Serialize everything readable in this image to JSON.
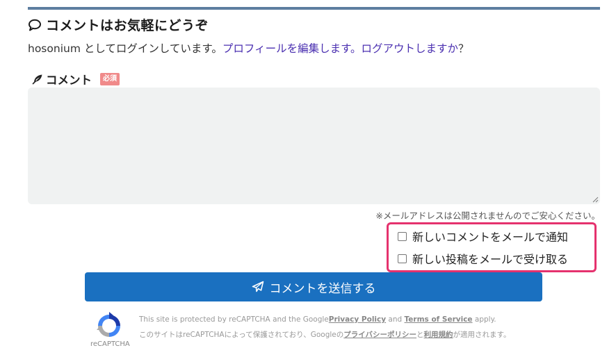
{
  "header": {
    "title": "コメントはお気軽にどうぞ",
    "login_user_text": "hosonium としてログインしています。",
    "edit_profile_link": "プロフィールを編集します。",
    "logout_link": "ログアウトしますか",
    "logout_suffix": "？"
  },
  "comment_field": {
    "label": "コメント",
    "required_badge": "必須",
    "value": "",
    "placeholder": ""
  },
  "notice": "※メールアドレスは公開されませんのでご安心ください。",
  "options": [
    {
      "label": "新しいコメントをメールで通知",
      "checked": false
    },
    {
      "label": "新しい投稿をメールで受け取る",
      "checked": false
    }
  ],
  "submit": {
    "label": "コメントを送信する"
  },
  "recaptcha": {
    "logo_label": "reCAPTCHA",
    "line1_prefix": "This site is protected by reCAPTCHA and the Google",
    "privacy_link": "Privacy Policy",
    "line1_and": " and ",
    "terms_link": "Terms of Service",
    "line1_suffix": " apply.",
    "line2_prefix": "このサイトはreCAPTCHAによって保護されており、Googleの",
    "privacy_link_ja": "プライバシーポリシー",
    "line2_and": "と",
    "terms_link_ja": "利用規約",
    "line2_suffix": "が適用されます。"
  },
  "colors": {
    "accent_rule": "#5d7ea0",
    "link": "#4a2fb0",
    "required_badge": "#f08a8a",
    "highlight_box": "#e5326e",
    "submit_button": "#1a70c0",
    "textarea_bg": "#f0f2f2"
  },
  "icons": [
    "speech-bubble-icon",
    "feather-icon",
    "resize-grip-icon",
    "paper-plane-icon",
    "recaptcha-logo-icon"
  ]
}
